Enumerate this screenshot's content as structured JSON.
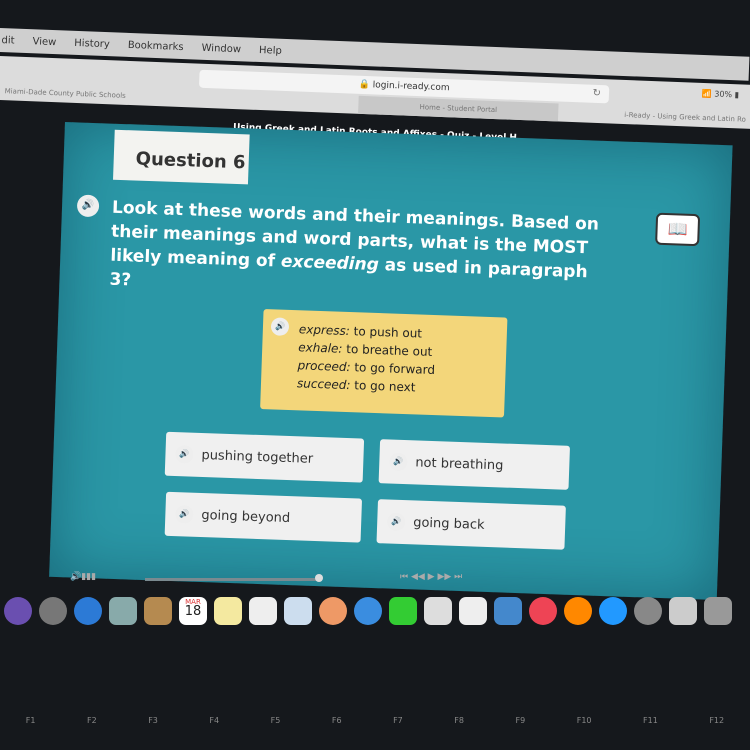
{
  "menu": [
    "dit",
    "View",
    "History",
    "Bookmarks",
    "Window",
    "Help"
  ],
  "browser": {
    "url": "login.i-ready.com",
    "battery": "30%",
    "tabs": [
      "Miami-Dade County Public Schools",
      "Home - Student Portal",
      "i-Ready - Using Greek and Latin Ro"
    ]
  },
  "page_title": "Using Greek and Latin Roots and Affixes - Quiz - Level H",
  "quiz": {
    "question_label": "Question 6",
    "question_parts": [
      "Look at these words and their meanings. Based on their meanings and word parts, what is the MOST likely meaning of ",
      "exceeding",
      " as used in paragraph 3?"
    ],
    "definitions": [
      {
        "word": "express:",
        "meaning": " to push out"
      },
      {
        "word": "exhale:",
        "meaning": " to breathe out"
      },
      {
        "word": "proceed:",
        "meaning": " to go forward"
      },
      {
        "word": "succeed:",
        "meaning": " to go next"
      }
    ],
    "answers": [
      "pushing together",
      "not breathing",
      "going beyond",
      "going back"
    ]
  },
  "dock": {
    "calendar_month": "MAR",
    "calendar_day": "18"
  },
  "keys": [
    "F1",
    "F2",
    "F3",
    "F4",
    "F5",
    "F6",
    "F7",
    "F8",
    "F9",
    "F10",
    "F11",
    "F12"
  ],
  "colors": {
    "panel": "#2a97a6",
    "card": "#f3d67a"
  }
}
